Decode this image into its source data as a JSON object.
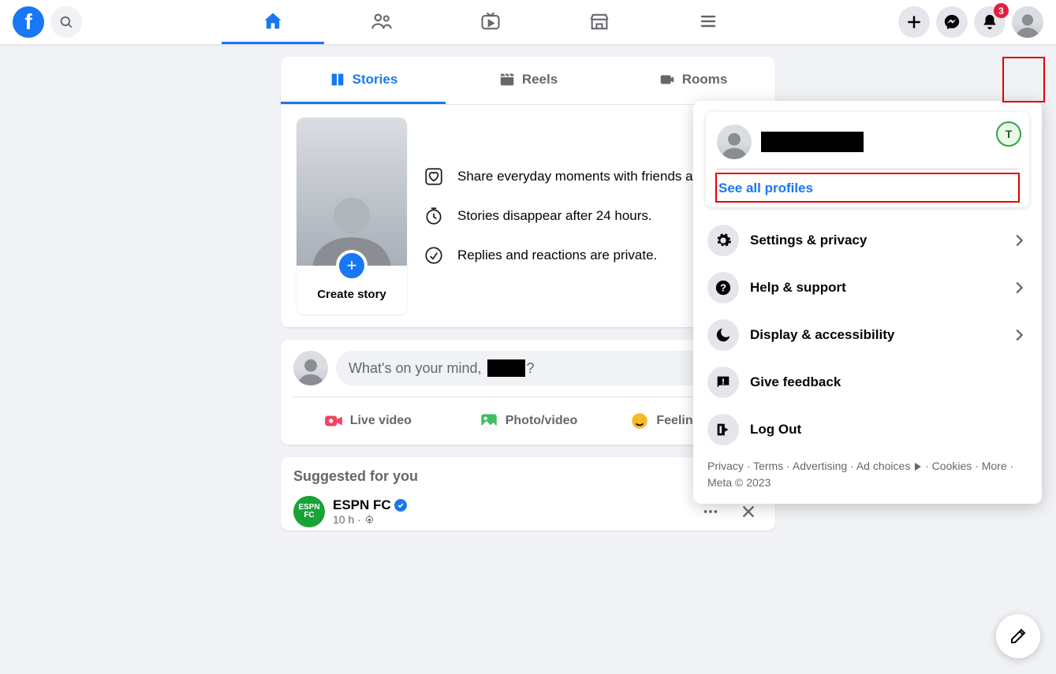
{
  "header": {
    "notification_count": "3"
  },
  "stories_tabs": {
    "stories": "Stories",
    "reels": "Reels",
    "rooms": "Rooms"
  },
  "stories": {
    "create_label": "Create story",
    "point1": "Share everyday moments with friends and family.",
    "point2": "Stories disappear after 24 hours.",
    "point3": "Replies and reactions are private."
  },
  "composer": {
    "prompt_prefix": "What's on your mind,",
    "prompt_suffix": "?",
    "live": "Live video",
    "photo": "Photo/video",
    "feeling": "Feeling/activity"
  },
  "suggested": {
    "title": "Suggested for you",
    "name": "ESPN FC",
    "avatar_text": "ESPN FC",
    "time": "10 h"
  },
  "menu": {
    "see_all": "See all profiles",
    "badge_letter": "T",
    "items": [
      {
        "label": "Settings & privacy",
        "has_chevron": true
      },
      {
        "label": "Help & support",
        "has_chevron": true
      },
      {
        "label": "Display & accessibility",
        "has_chevron": true
      },
      {
        "label": "Give feedback",
        "has_chevron": false
      },
      {
        "label": "Log Out",
        "has_chevron": false
      }
    ],
    "footer": {
      "links": [
        "Privacy",
        "Terms",
        "Advertising",
        "Ad choices",
        "Cookies",
        "More"
      ],
      "meta": "Meta © 2023"
    }
  }
}
